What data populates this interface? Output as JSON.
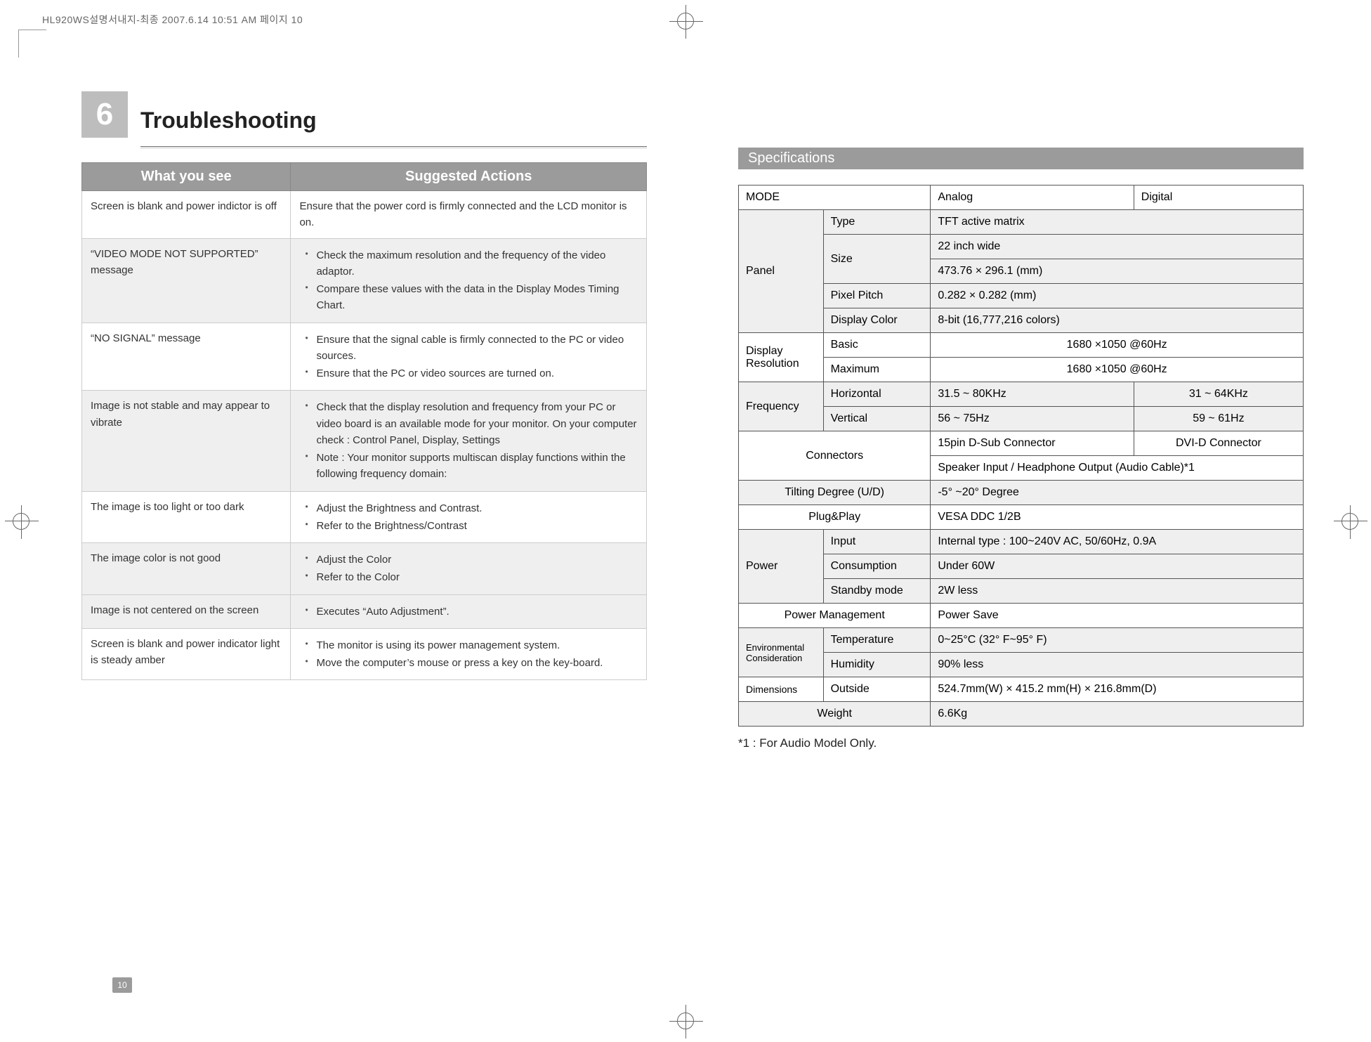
{
  "print": {
    "header": "HL920WS설명서내지-최종  2007.6.14 10:51 AM  페이지 10",
    "page_number": "10"
  },
  "section": {
    "number": "6",
    "title": "Troubleshooting"
  },
  "trouble": {
    "head_left": "What you see",
    "head_right": "Suggested Actions",
    "rows": [
      {
        "see": "Screen is blank and power indictor is off",
        "act": "Ensure that the power cord is firmly connected and the LCD monitor is on."
      },
      {
        "see": "“VIDEO MODE NOT SUPPORTED” message",
        "act1": "Check the maximum resolution and the frequency of the video adaptor.",
        "act2": "Compare these values with the data in the Display Modes Timing Chart."
      },
      {
        "see": "“NO SIGNAL” message",
        "act1": "Ensure that the signal cable is firmly connected to the PC or video sources.",
        "act2": "Ensure that the PC or video sources are turned on."
      },
      {
        "see": "Image is not stable and may appear to vibrate",
        "act1": "Check that the display resolution and frequency from your PC or video board is an available mode for your monitor. On your computer check : Control Panel, Display, Settings",
        "note": "Note : Your monitor supports multiscan display functions within the following frequency domain:"
      },
      {
        "see": "The image is too light or too dark",
        "act1": "Adjust the Brightness and Contrast.",
        "act2": "Refer  to the Brightness/Contrast"
      },
      {
        "see": "The image color is not good",
        "act1": "Adjust the Color",
        "act2": "Refer to the Color"
      },
      {
        "see": "Image is not centered on the screen",
        "act1": "Executes “Auto Adjustment”."
      },
      {
        "see": "Screen is blank and power indicator light is steady amber",
        "act1": "The monitor is using its power management system.",
        "act2": "Move the computer’s mouse or press a key on the key-board."
      }
    ]
  },
  "spec": {
    "heading": "Specifications",
    "mode": "MODE",
    "analog": "Analog",
    "digital": "Digital",
    "panel": "Panel",
    "type": "Type",
    "type_v": "TFT active matrix",
    "size": "Size",
    "size_v1": "22 inch wide",
    "size_v2": "473.76 × 296.1  (mm)",
    "pp": "Pixel Pitch",
    "pp_v": "  0.282 × 0.282  (mm)",
    "dc": "Display Color",
    "dc_v": "8-bit (16,777,216 colors)",
    "dres": "Display Resolution",
    "basic": "Basic",
    "basic_v": "1680 ×1050 @60Hz",
    "max": "Maximum",
    "max_v": "1680 ×1050 @60Hz",
    "freq": "Frequency",
    "horiz": "Horizontal",
    "horiz_a": "31.5 ~ 80KHz",
    "horiz_d": "31 ~ 64KHz",
    "vert": "Vertical",
    "vert_a": "56 ~ 75Hz",
    "vert_d": "59 ~ 61Hz",
    "conn": "Connectors",
    "conn_a": "15pin D-Sub Connector",
    "conn_d": "DVI-D Connector",
    "conn_audio": "Speaker Input / Headphone Output (Audio Cable)*1",
    "tilt": "Tilting Degree (U/D)",
    "tilt_v": "-5° ~20° Degree",
    "pnp": "Plug&Play",
    "pnp_v": "VESA DDC 1/2B",
    "power": "Power",
    "pin": "Input",
    "pin_v": " Internal type : 100~240V  AC, 50/60Hz, 0.9A",
    "pcons": "Consumption",
    "pcons_v": "Under 60W",
    "pstby": "Standby mode",
    "pstby_v": "2W less",
    "pmgmt": "Power Management",
    "pmgmt_v": "Power Save",
    "env": "Environmental Consideration",
    "temp": "Temperature",
    "temp_v": "0~25°C  (32° F~95° F)",
    "hum": "Humidity",
    "hum_v": "90% less",
    "dim": "Dimensions",
    "outside": "Outside",
    "outside_v": "524.7mm(W) × 415.2 mm(H) × 216.8mm(D)",
    "weight": "Weight",
    "weight_v": "6.6Kg",
    "footnote": "*1 : For Audio Model Only."
  }
}
